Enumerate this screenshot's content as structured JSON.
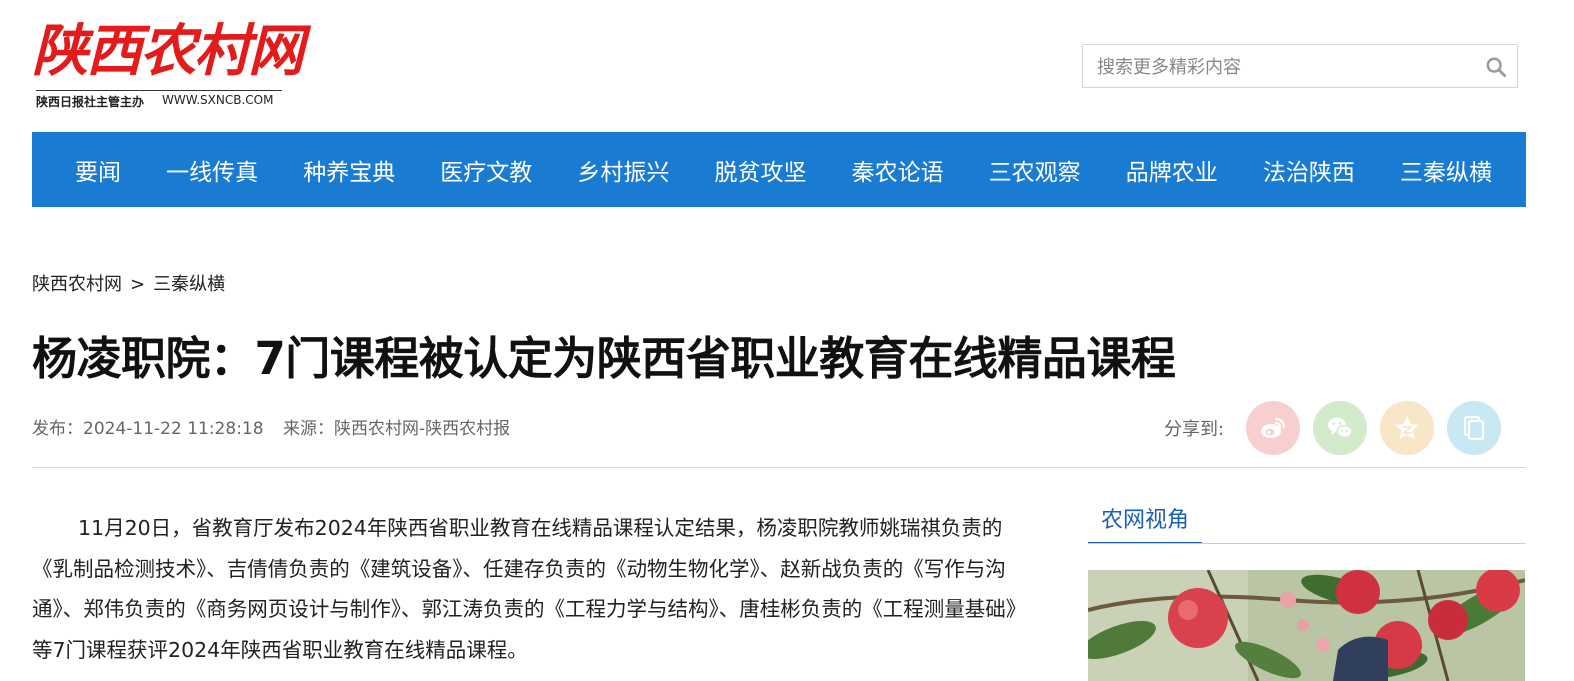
{
  "header": {
    "logo_text": "陕西农村网",
    "logo_org": "陕西日报社主管主办",
    "logo_url": "WWW.SXNCB.COM"
  },
  "search": {
    "placeholder": "搜索更多精彩内容",
    "value": ""
  },
  "nav": {
    "items": [
      {
        "label": "要闻"
      },
      {
        "label": "一线传真"
      },
      {
        "label": "种养宝典"
      },
      {
        "label": "医疗文教"
      },
      {
        "label": "乡村振兴"
      },
      {
        "label": "脱贫攻坚"
      },
      {
        "label": "秦农论语"
      },
      {
        "label": "三农观察"
      },
      {
        "label": "品牌农业"
      },
      {
        "label": "法治陕西"
      },
      {
        "label": "三秦纵横"
      }
    ]
  },
  "breadcrumb": {
    "home": "陕西农村网",
    "separator": ">",
    "current": "三秦纵横"
  },
  "article": {
    "title": "杨凌职院：7门课程被认定为陕西省职业教育在线精品课程",
    "publish_label": "发布：",
    "publish_time": "2024-11-22 11:28:18",
    "source_label": "来源：",
    "source": "陕西农村网-陕西农村报",
    "body": "11月20日，省教育厅发布2024年陕西省职业教育在线精品课程认定结果，杨凌职院教师姚瑞祺负责的《乳制品检测技术》、吉倩倩负责的《建筑设备》、任建存负责的《动物生物化学》、赵新战负责的《写作与沟通》、郑伟负责的《商务网页设计与制作》、郭江涛负责的《工程力学与结构》、唐桂彬负责的《工程测量基础》等7门课程获评2024年陕西省职业教育在线精品课程。"
  },
  "share": {
    "label": "分享到:",
    "buttons": [
      {
        "icon": "weibo-icon",
        "bg": "#f8cfcf",
        "fg": "#ffffff"
      },
      {
        "icon": "wechat-icon",
        "bg": "#d3ebcb",
        "fg": "#ffffff"
      },
      {
        "icon": "qzone-star-icon",
        "bg": "#f8e6c6",
        "fg": "#ffffff"
      },
      {
        "icon": "copy-link-icon",
        "bg": "#c8e8f3",
        "fg": "#ffffff"
      }
    ]
  },
  "sidebar": {
    "tab_label": "农网视角"
  },
  "colors": {
    "nav_bg": "#1a7bd3",
    "accent": "#1a5fb4",
    "logo_red": "#e31b1b"
  }
}
